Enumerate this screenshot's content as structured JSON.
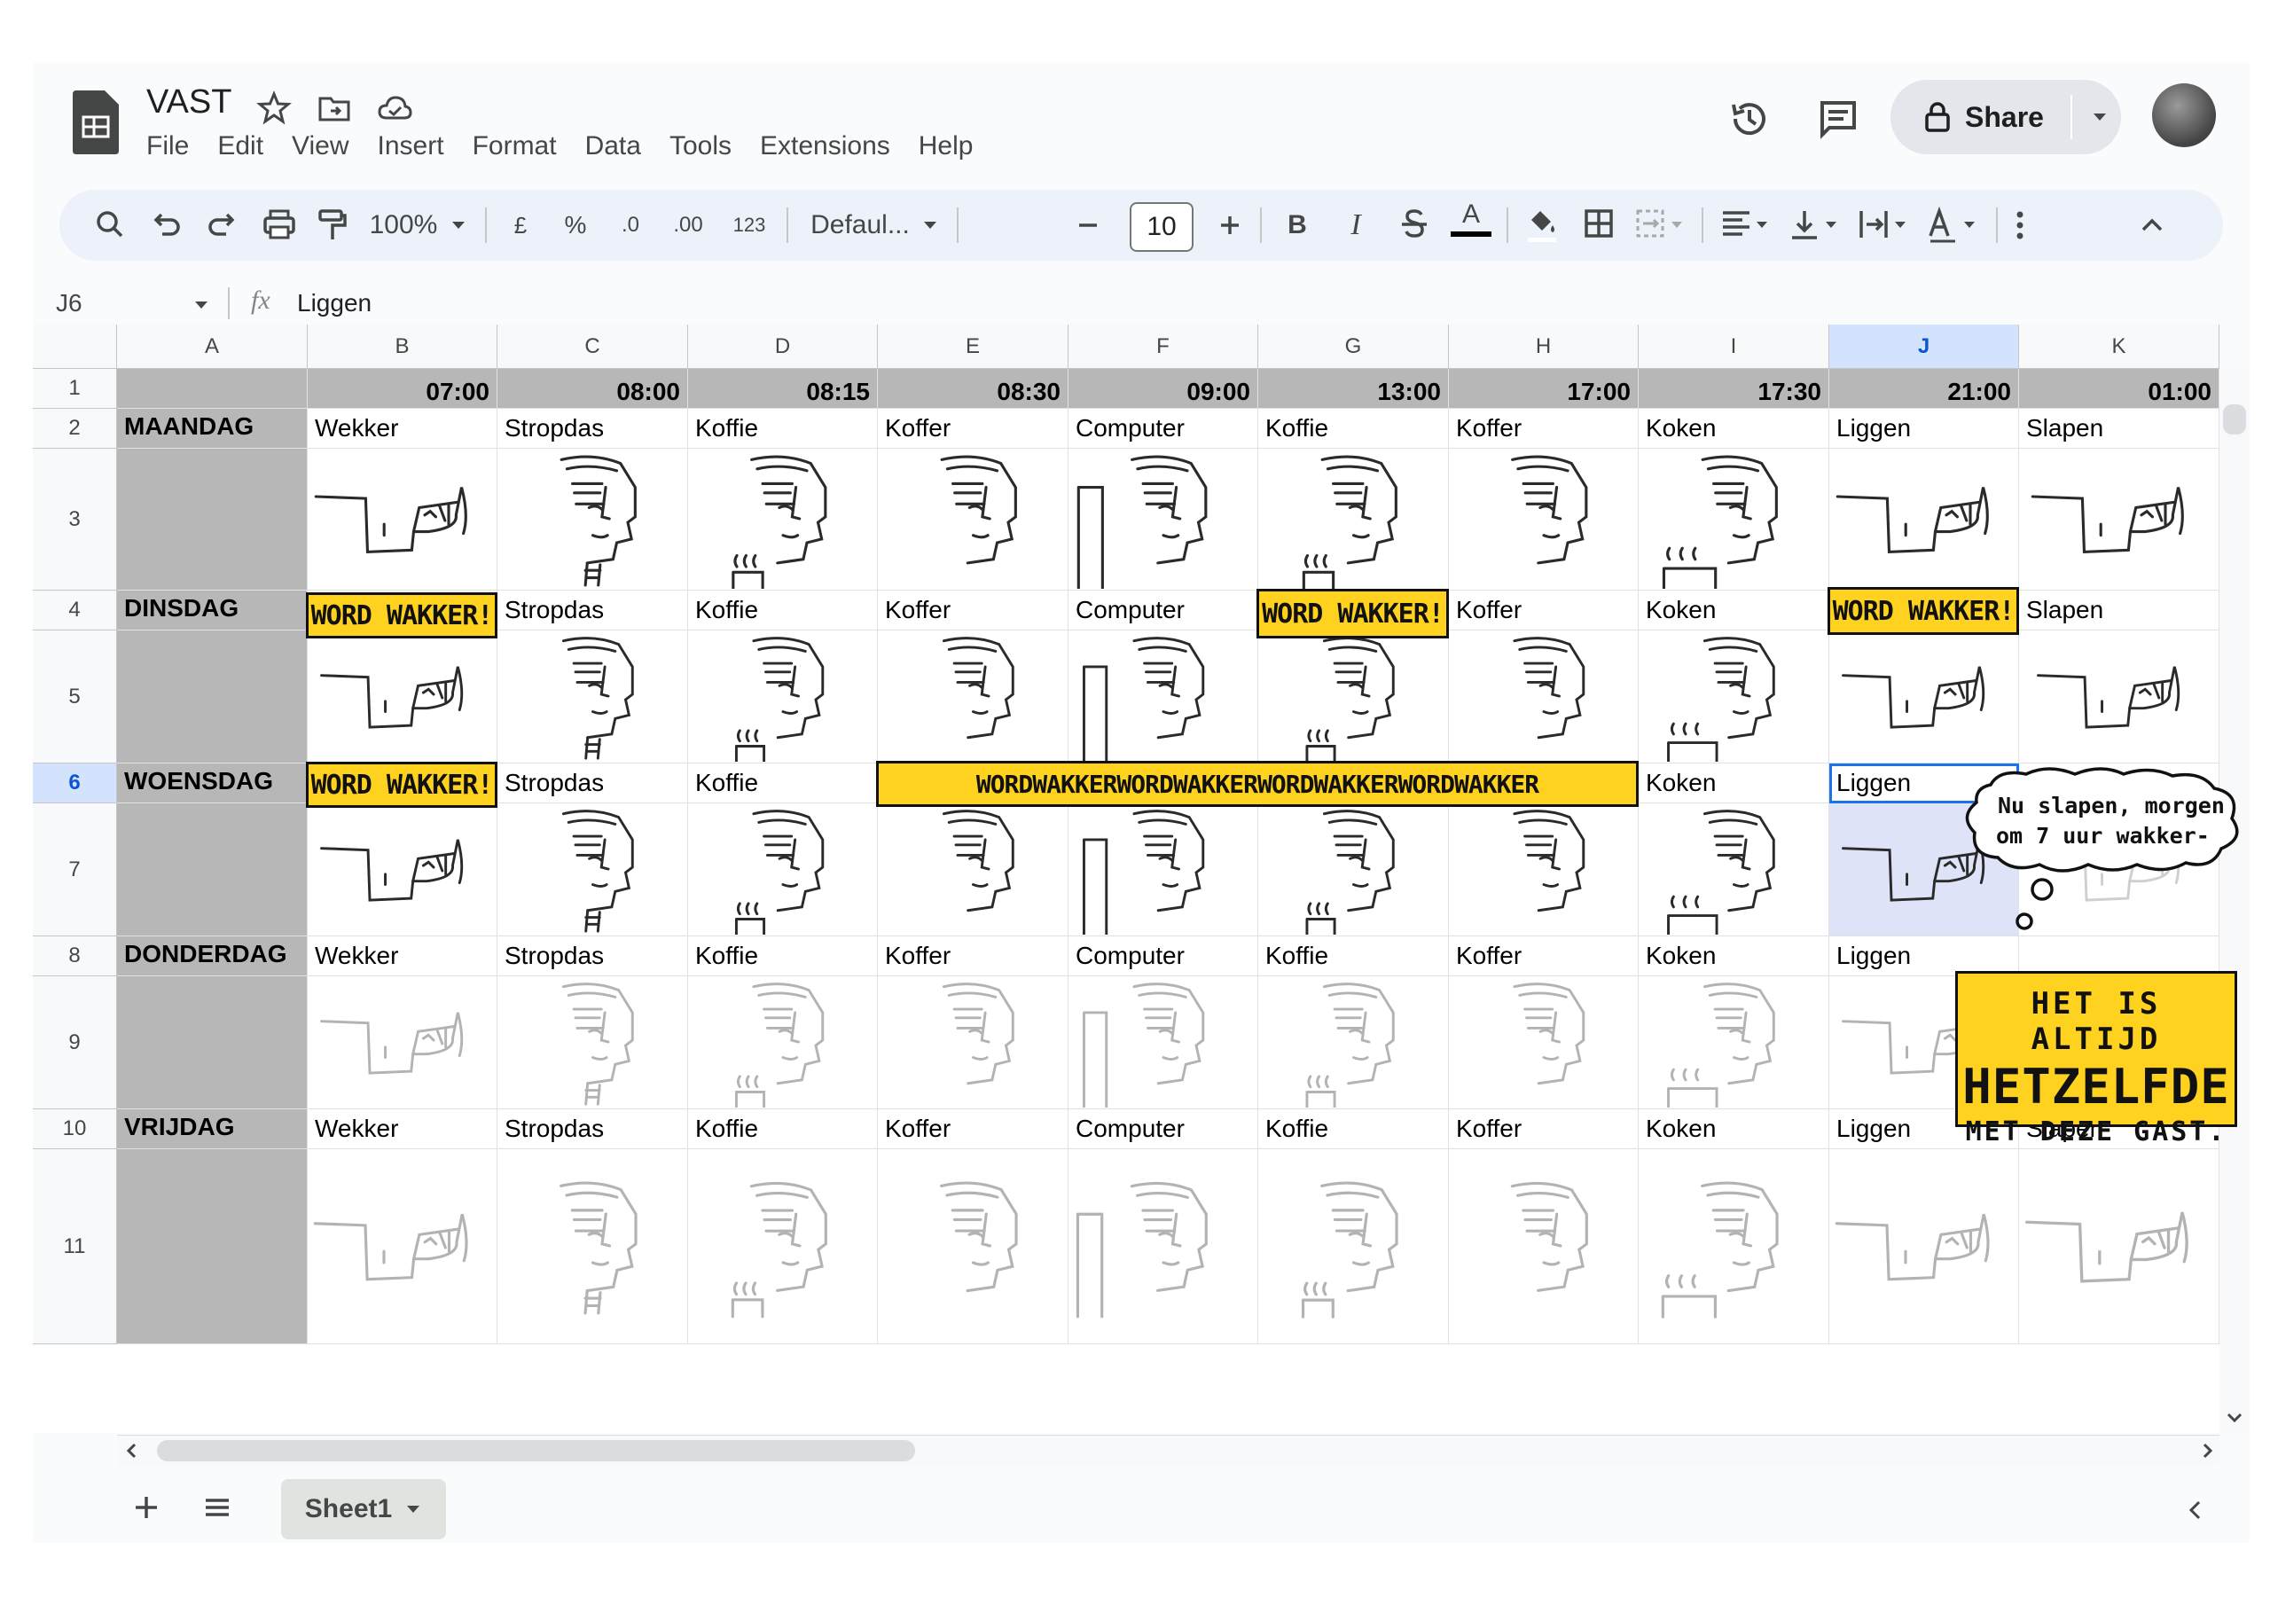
{
  "document": {
    "title": "VAST",
    "menu": [
      "File",
      "Edit",
      "View",
      "Insert",
      "Format",
      "Data",
      "Tools",
      "Extensions",
      "Help"
    ],
    "share_label": "Share"
  },
  "toolbar": {
    "zoom": "100%",
    "currency": "£",
    "percent": "%",
    "decrease_decimal": ".0",
    "increase_decimal": ".00",
    "number_format": "123",
    "font": "Defaul...",
    "font_size": "10",
    "bold": "B",
    "italic": "I",
    "text_color_glyph": "A"
  },
  "formula_bar": {
    "cell_ref": "J6",
    "fx": "fx",
    "value": "Liggen"
  },
  "columns": [
    "A",
    "B",
    "C",
    "D",
    "E",
    "F",
    "G",
    "H",
    "I",
    "J",
    "K"
  ],
  "rows": [
    "1",
    "2",
    "3",
    "4",
    "5",
    "6",
    "7",
    "8",
    "9",
    "10",
    "11"
  ],
  "selected_cell": {
    "column": "J",
    "row": "6"
  },
  "times": [
    "07:00",
    "08:00",
    "08:15",
    "08:30",
    "09:00",
    "13:00",
    "17:00",
    "17:30",
    "21:00",
    "01:00"
  ],
  "days": [
    {
      "name": "MAANDAG",
      "activities": [
        "Wekker",
        "Stropdas",
        "Koffie",
        "Koffer",
        "Computer",
        "Koffie",
        "Koffer",
        "Koken",
        "Liggen",
        "Slapen"
      ]
    },
    {
      "name": "DINSDAG",
      "activities": [
        "",
        "Stropdas",
        "Koffie",
        "Koffer",
        "Computer",
        "",
        "Koffer",
        "Koken",
        "",
        "Slapen"
      ]
    },
    {
      "name": "WOENSDAG",
      "activities": [
        "",
        "Stropdas",
        "Koffie",
        "",
        "",
        "",
        "",
        "Koken",
        "Liggen",
        ""
      ]
    },
    {
      "name": "DONDERDAG",
      "activities": [
        "Wekker",
        "Stropdas",
        "Koffie",
        "Koffer",
        "Computer",
        "Koffie",
        "Koffer",
        "Koken",
        "Liggen",
        ""
      ]
    },
    {
      "name": "VRIJDAG",
      "activities": [
        "Wekker",
        "Stropdas",
        "Koffie",
        "Koffer",
        "Computer",
        "Koffie",
        "Koffer",
        "Koken",
        "Liggen",
        "Slapen"
      ]
    }
  ],
  "overlays": {
    "word_wakker": "WORD WAKKER!",
    "word_wakker_long": "WORDWAKKERWORDWAKKERWORDWAKKERWORDWAKKER",
    "thought_line1": "Nu slapen, morgen",
    "thought_line2": "om 7 uur wakker-",
    "box_line1": "HET IS ALTIJD",
    "box_line2": "HETZELFDE",
    "box_line3": "MET DEZE GAST."
  },
  "sheet_tab": "Sheet1",
  "colors": {
    "accent": "#1a73e8",
    "highlight": "#ffd21f",
    "header_grey": "#b7b7b7"
  }
}
